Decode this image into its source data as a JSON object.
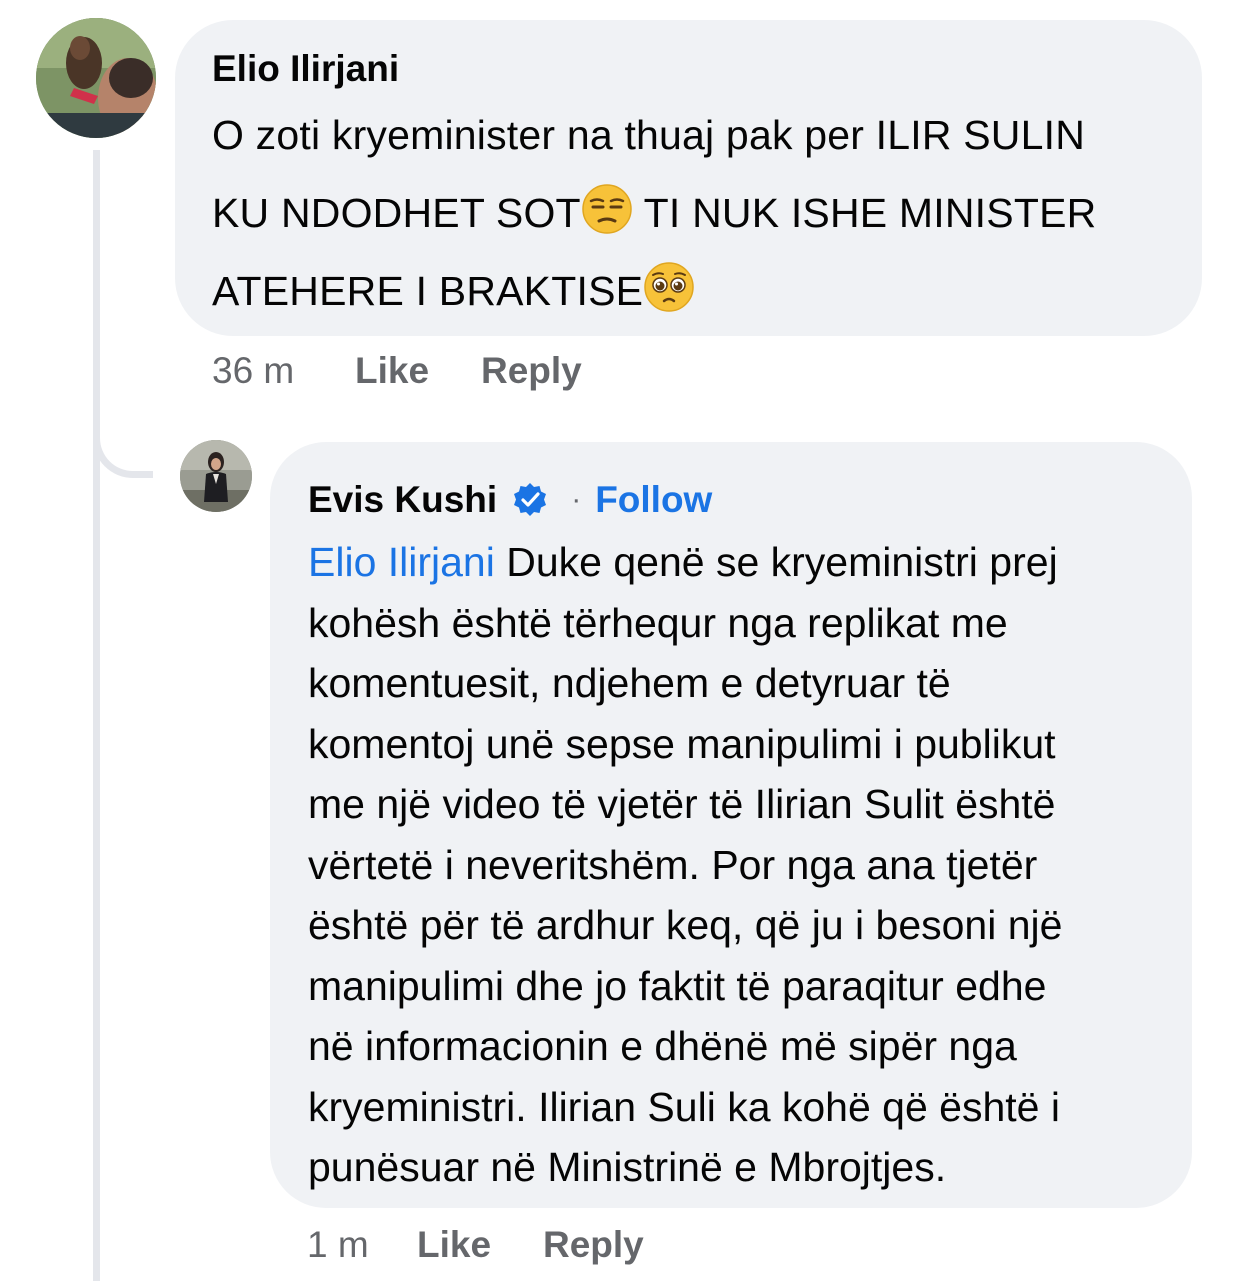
{
  "comment1": {
    "author": "Elio Ilirjani",
    "line1": "O zoti kryeminister na thuaj pak per ILIR SULIN",
    "line2_text": "KU NDODHET SOT",
    "line2_emoji": "unamused-face-emoji",
    "line2_rest": " TI NUK ISHE MINISTER",
    "line3_text": "ATEHERE I BRAKTISE",
    "line3_emoji": "pleading-face-emoji",
    "time": "36 m",
    "like_label": "Like",
    "reply_label": "Reply"
  },
  "comment2": {
    "author": "Evis Kushi",
    "verified_icon": "verified-badge-icon",
    "separator": "·",
    "follow_label": "Follow",
    "mention": "Elio Ilirjani",
    "lines": [
      " Duke qenë se kryeministri prej",
      "kohësh është tërhequr nga replikat me",
      "komentuesit, ndjehem e detyruar të",
      "komentoj unë sepse manipulimi i publikut",
      "me një video të vjetër të Ilirian Sulit është",
      "vërtetë i neveritshëm. Por nga ana tjetër",
      "është për të ardhur keq, që ju i besoni një",
      "manipulimi dhe jo faktit të paraqitur edhe",
      "në informacionin e dhënë më sipër nga",
      "kryeministri. Ilirian Suli ka kohë që është i",
      "punësuar në Ministrinë e Mbrojtjes."
    ],
    "time": "1 m",
    "like_label": "Like",
    "reply_label": "Reply"
  },
  "colors": {
    "bubble": "#f0f2f5",
    "link": "#1b74e4",
    "meta": "#65676b",
    "thread_line": "#e4e6eb"
  }
}
